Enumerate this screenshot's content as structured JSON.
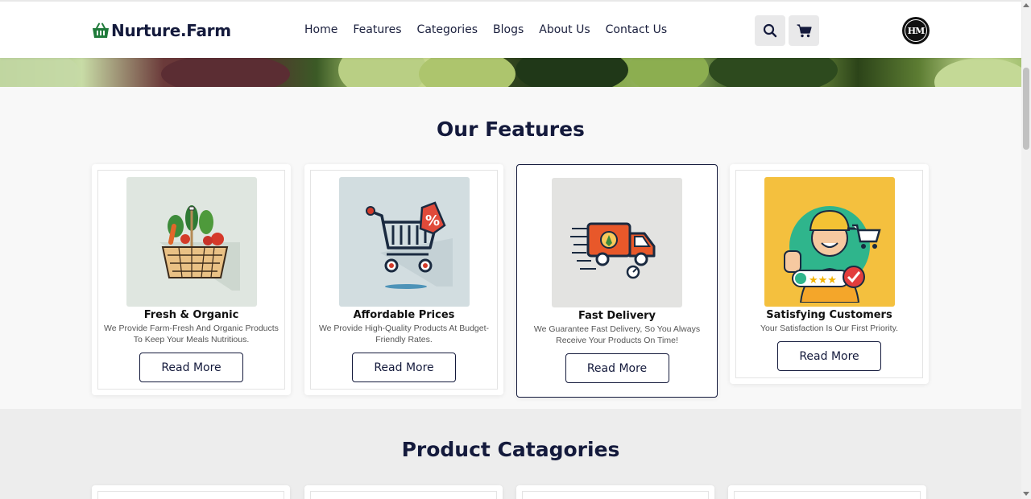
{
  "header": {
    "logo_text": "Nurture.Farm",
    "nav": [
      "Home",
      "Features",
      "Categories",
      "Blogs",
      "About Us",
      "Contact Us"
    ],
    "avatar_text": "HM"
  },
  "features": {
    "title": "Our Features",
    "cards": [
      {
        "title": "Fresh & Organic",
        "desc": "We Provide Farm-Fresh And Organic Products To Keep Your Meals Nutritious.",
        "button": "Read More",
        "icon": "vegetable-basket-icon"
      },
      {
        "title": "Affordable Prices",
        "desc": "We Provide High-Quality Products At Budget-Friendly Rates.",
        "button": "Read More",
        "icon": "discount-cart-icon"
      },
      {
        "title": "Fast Delivery",
        "desc": "We Guarantee Fast Delivery, So You Always Receive Your Products On Time!",
        "button": "Read More",
        "icon": "delivery-truck-icon"
      },
      {
        "title": "Satisfying Customers",
        "desc": "Your Satisfaction Is Our First Priority.",
        "button": "Read More",
        "icon": "happy-customer-icon"
      }
    ]
  },
  "categories": {
    "title": "Product Catagories"
  },
  "colors": {
    "brand_dark": "#141a3c",
    "brand_green": "#1f7a3a"
  }
}
